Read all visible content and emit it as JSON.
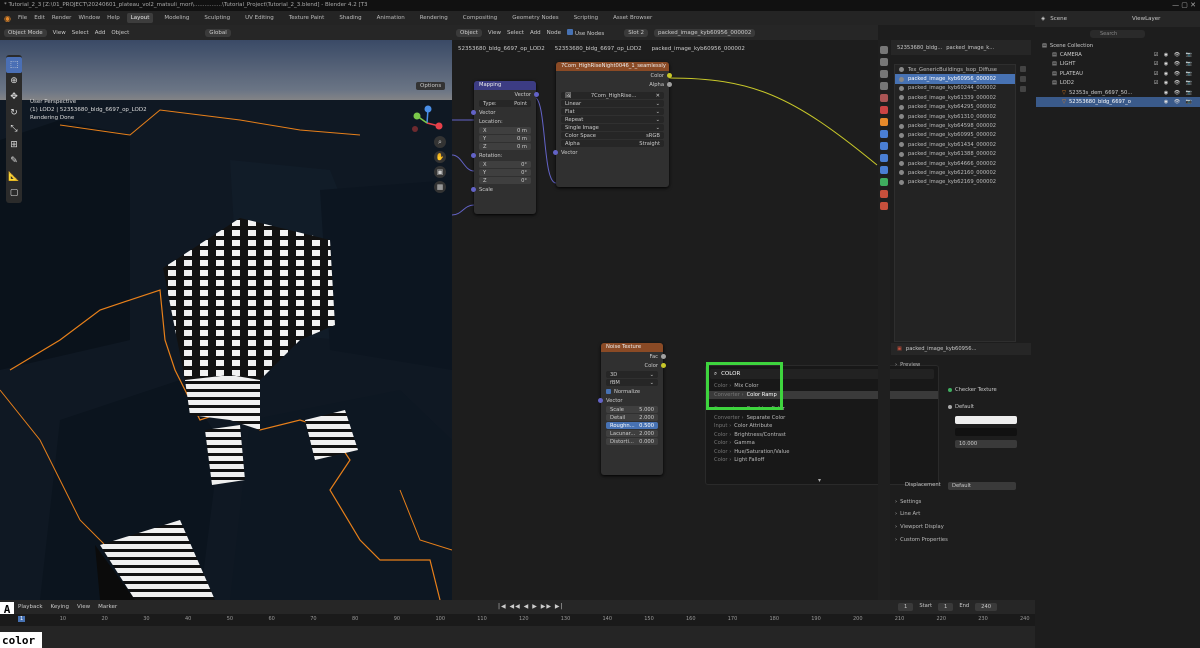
{
  "window": {
    "title": "* Tutorial_2_3 [Z:\\01_PROJECT\\20240601_plateau_vol2_matsuli_mori\\................\\Tutorial_Project\\Tutorial_2_3.blend] - Blender 4.2 [T3",
    "controls": "—  ▢  ✕"
  },
  "menu": {
    "items": [
      "File",
      "Edit",
      "Render",
      "Window",
      "Help"
    ],
    "workspaces": [
      "Layout",
      "Modeling",
      "Sculpting",
      "UV Editing",
      "Texture Paint",
      "Shading",
      "Animation",
      "Rendering",
      "Compositing",
      "Geometry Nodes",
      "Scripting",
      "Asset Browser"
    ],
    "active_workspace": "Layout"
  },
  "viewport": {
    "header": [
      "Object Mode",
      "View",
      "Select",
      "Add",
      "Object",
      "Global"
    ],
    "options_label": "Options",
    "info": [
      "User Perspective",
      "(1) LOD2 | 52353680_bldg_6697_op_LOD2",
      "Rendering Done"
    ]
  },
  "node_editor": {
    "header": [
      "Object",
      "View",
      "Select",
      "Add",
      "Node",
      "Use Nodes",
      "Slot 2",
      "packed_image_kyb60956_000002"
    ],
    "use_nodes_checked": true,
    "breadcrumb": [
      "52353680_bldg_6697_op_LOD2",
      "52353680_bldg_6697_op_LOD2",
      "packed_image_kyb60956_000002"
    ],
    "mapping": {
      "title": "Mapping",
      "output": "Vector",
      "type_label": "Type:",
      "type_value": "Point",
      "vector_label": "Vector",
      "location_label": "Location:",
      "location": [
        [
          "X",
          "0 m"
        ],
        [
          "Y",
          "0 m"
        ],
        [
          "Z",
          "0 m"
        ]
      ],
      "rotation_label": "Rotation:",
      "rotation": [
        [
          "X",
          "0°"
        ],
        [
          "Y",
          "0°"
        ],
        [
          "Z",
          "0°"
        ]
      ],
      "scale_label": "Scale"
    },
    "image_texture": {
      "title": "7Com_HighRiseNight0046_1_seamlessly",
      "outputs": [
        "Color",
        "Alpha"
      ],
      "image_name": "7Com_HighRise...",
      "dropdowns": [
        "Linear",
        "Flat",
        "Repeat",
        "Single Image"
      ],
      "color_space_label": "Color Space",
      "color_space_value": "sRGB",
      "alpha_label": "Alpha",
      "alpha_value": "Straight",
      "input": "Vector"
    },
    "noise_texture": {
      "title": "Noise Texture",
      "outputs": [
        "Fac",
        "Color"
      ],
      "dimension": "3D",
      "basis": "fBM",
      "normalize_label": "Normalize",
      "normalize_checked": true,
      "vector_label": "Vector",
      "fields": [
        [
          "Scale",
          "5.000"
        ],
        [
          "Detail",
          "2.000"
        ],
        [
          "Roughn...",
          "0.500"
        ],
        [
          "Lacunar...",
          "2.000"
        ],
        [
          "Distorti...",
          "0.000"
        ]
      ]
    },
    "search_popup": {
      "query": "COLOR",
      "results": [
        {
          "category": "Color ›",
          "name": "Mix Color",
          "highlight": false
        },
        {
          "category": "Converter ›",
          "name": "Color Ramp",
          "highlight": true
        },
        {
          "category": "Converter ›",
          "name": "Combine Color",
          "highlight": false
        },
        {
          "category": "Converter ›",
          "name": "Separate Color",
          "highlight": false
        },
        {
          "category": "Input ›",
          "name": "Color Attribute",
          "highlight": false
        },
        {
          "category": "Color ›",
          "name": "Brightness/Contrast",
          "highlight": false
        },
        {
          "category": "Color ›",
          "name": "Gamma",
          "highlight": false
        },
        {
          "category": "Color ›",
          "name": "Hue/Saturation/Value",
          "highlight": false
        },
        {
          "category": "Color ›",
          "name": "Light Falloff",
          "highlight": false
        }
      ],
      "more": "▾"
    }
  },
  "image_panel": {
    "header": [
      "52353680_bldg...",
      "packed_image_k..."
    ],
    "items": [
      "Tex_GenericBuildings_Isop_Diffuse",
      "packed_image_kyb60956_000002",
      "packed_image_kyb60244_000002",
      "packed_image_kyb61339_000002",
      "packed_image_kyb64295_000002",
      "packed_image_kyb61310_000002",
      "packed_image_kyb64598_000002",
      "packed_image_kyb60995_000002",
      "packed_image_kyb61434_000002",
      "packed_image_kyb61388_000002",
      "packed_image_kyb64666_000002",
      "packed_image_kyb62160_000002",
      "packed_image_kyb62169_000002"
    ],
    "selected_index": 1
  },
  "properties": {
    "header": "packed_image_kyb60956...",
    "sections": [
      "Preview",
      "Settings",
      "Line Art",
      "Viewport Display",
      "Custom Properties"
    ],
    "checker_label": "Checker Texture",
    "default_label": "Default",
    "value_field": "10.000",
    "displacement_label": "Displacement",
    "displacement_value": "Default"
  },
  "outliner": {
    "header": "Scene",
    "view_layer": "ViewLayer",
    "search_placeholder": "Search",
    "rows": [
      {
        "label": "Scene Collection",
        "indent": 0,
        "selected": false,
        "vis": ""
      },
      {
        "label": "CAMERA",
        "indent": 1,
        "selected": false,
        "vis": "☑ ◉ 👁 📷"
      },
      {
        "label": "LIGHT",
        "indent": 1,
        "selected": false,
        "vis": "☑ ◉ 👁 📷"
      },
      {
        "label": "PLATEAU",
        "indent": 1,
        "selected": false,
        "vis": "☑ ◉ 👁 📷"
      },
      {
        "label": "LOD2",
        "indent": 1,
        "selected": false,
        "vis": "☑ ◉ 👁 📷"
      },
      {
        "label": "52353s_dem_6697_50...",
        "indent": 2,
        "selected": false,
        "vis": "◉ 👁 📷"
      },
      {
        "label": "52353680_bldg_6697_o",
        "indent": 2,
        "selected": true,
        "vis": "◉ 👁 📷"
      }
    ]
  },
  "timeline": {
    "mode_label": "A",
    "menus": [
      "Playback",
      "Keying",
      "View",
      "Marker"
    ],
    "controls": "|◀ ◀◀ ◀ ▶ ▶▶ ▶|",
    "current_frame": "1",
    "start_label": "Start",
    "start": "1",
    "end_label": "End",
    "end": "240",
    "ruler": [
      "1",
      "10",
      "20",
      "30",
      "40",
      "50",
      "60",
      "70",
      "80",
      "90",
      "100",
      "110",
      "120",
      "130",
      "140",
      "150",
      "160",
      "170",
      "180",
      "190",
      "200",
      "210",
      "220",
      "230",
      "240"
    ],
    "key_overlay": "color"
  },
  "colors": {
    "selection": "#4772b3",
    "highlight_box": "#3ed43e",
    "wire_yellow": "#c7c729",
    "wire_vector": "#6363c7",
    "outline_orange": "#e8801a"
  }
}
